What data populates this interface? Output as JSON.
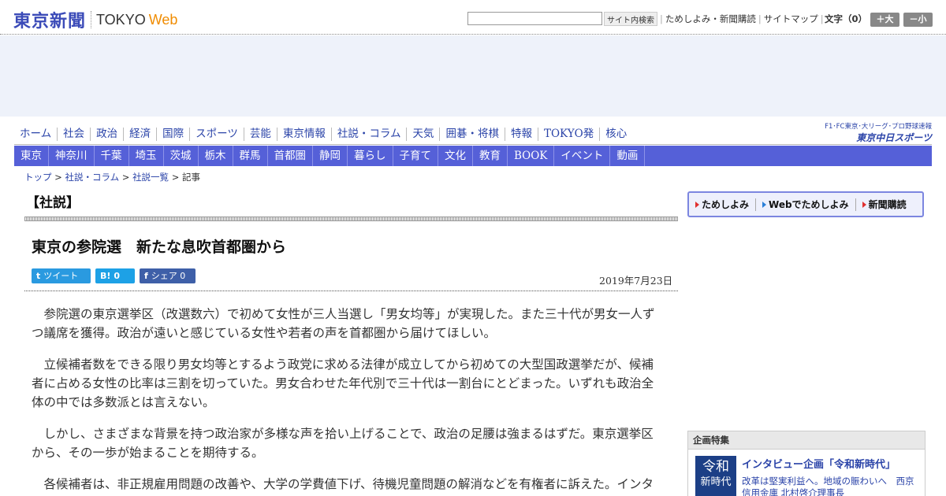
{
  "header": {
    "logo_jp": "東京新聞",
    "logo_tokyo": "TOKYO",
    "logo_web": "Web",
    "search_placeholder": "",
    "search_button": "サイト内検索",
    "links": [
      "ためしよみ・新聞購読",
      "サイトマップ"
    ],
    "font_size_label": "文字（0）",
    "font_larger": "＋大",
    "font_smaller": "－小"
  },
  "nav": {
    "primary": [
      "ホーム",
      "社会",
      "政治",
      "経済",
      "国際",
      "スポーツ",
      "芸能",
      "東京情報",
      "社説・コラム",
      "天気",
      "囲碁・将棋",
      "特報",
      "TOKYO発",
      "核心"
    ],
    "regional": [
      "東京",
      "神奈川",
      "千葉",
      "埼玉",
      "茨城",
      "栃木",
      "群馬",
      "首都圏",
      "静岡",
      "暮らし",
      "子育て",
      "文化",
      "教育",
      "BOOK",
      "イベント",
      "動画"
    ],
    "chunichi_line1": "F1･FC東京･大リーグ･プロ野球速報",
    "chunichi_line2": "東京中日スポーツ"
  },
  "breadcrumb": [
    {
      "label": "トップ"
    },
    {
      "label": "社説・コラム"
    },
    {
      "label": "社説一覧"
    },
    {
      "label": "記事"
    }
  ],
  "breadcrumb_sep": ">",
  "section_title": "【社説】",
  "article": {
    "title": "東京の参院選　新たな息吹首都圏から",
    "date": "2019年7月23日",
    "share": {
      "tweet_icon": "t",
      "tweet_label": "ツイート",
      "hatena_icon": "B!",
      "hatena_count": "0",
      "facebook_icon": "f",
      "facebook_label": "シェア",
      "facebook_count": "0"
    },
    "paragraphs": [
      "参院選の東京選挙区（改選数六）で初めて女性が三人当選し「男女均等」が実現した。また三十代が男女一人ずつ議席を獲得。政治が遠いと感じている女性や若者の声を首都圏から届けてほしい。",
      "立候補者数をできる限り男女均等とするよう政党に求める法律が成立してから初めての大型国政選挙だが、候補者に占める女性の比率は三割を切っていた。男女合わせた年代別で三十代は一割台にとどまった。いずれも政治全体の中では多数派とは言えない。",
      "しかし、さまざまな背景を持つ政治家が多様な声を拾い上げることで、政治の足腰は強まるはずだ。東京選挙区から、その一歩が始まることを期待する。",
      "各候補者は、非正規雇用問題の改善や、大学の学費値下げ、待機児童問題の解消などを有権者に訴えた。インターネットなどを通じて若い世代の関心を集めた候補もいた。"
    ]
  },
  "sidebar": {
    "subscribe": [
      "ためしよみ",
      "Webでためしよみ",
      "新聞購読"
    ],
    "feature_heading": "企画特集",
    "feature_thumb_line1": "令和",
    "feature_thumb_line2": "新時代",
    "feature_title": "インタビュー企画「令和新時代」",
    "feature_desc": "改革は堅実利益へ。地域の賑わいへ　西京信用金庫 北村啓介理事長"
  },
  "colors": {
    "brand": "#3b4bb8",
    "web_accent": "#f08c00",
    "nav_bar": "#5560d8",
    "link": "#2a43a8"
  }
}
